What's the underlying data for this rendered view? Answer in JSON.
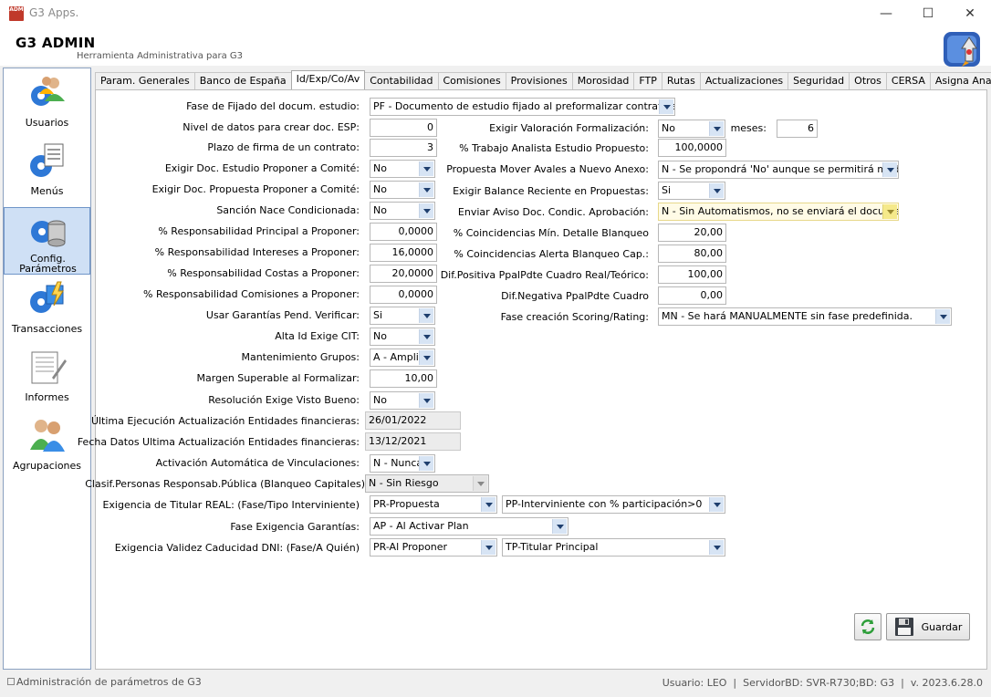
{
  "window": {
    "app_icon_text": "ADM",
    "title": "G3 Apps.",
    "minimize": "—",
    "maximize": "☐",
    "close": "✕"
  },
  "header": {
    "title": "G3 ADMIN",
    "subtitle": "Herramienta Administrativa para G3"
  },
  "sidebar": {
    "items": [
      {
        "label": "Usuarios",
        "icon": "users-gear-icon"
      },
      {
        "label": "Menús",
        "icon": "menu-gear-icon"
      },
      {
        "label": "Config. Parámetros",
        "icon": "database-gear-icon"
      },
      {
        "label": "Transacciones",
        "icon": "transaction-gear-icon"
      },
      {
        "label": "Informes",
        "icon": "report-icon"
      },
      {
        "label": "Agrupaciones",
        "icon": "group-icon"
      }
    ]
  },
  "tabs": [
    "Param. Generales",
    "Banco de España",
    "Id/Exp/Co/Av",
    "Contabilidad",
    "Comisiones",
    "Provisiones",
    "Morosidad",
    "FTP",
    "Rutas",
    "Actualizaciones",
    "Seguridad",
    "Otros",
    "CERSA",
    "Asigna Analista"
  ],
  "form": {
    "fase_fijado": {
      "label": "Fase de Fijado del docum. estudio:",
      "value": "PF - Documento de estudio fijado al preformalizar contrato/aval."
    },
    "nivel_datos": {
      "label": "Nivel de datos para crear doc. ESP:",
      "value": "0"
    },
    "plazo_firma": {
      "label": "Plazo de firma de un contrato:",
      "value": "3"
    },
    "exigir_doc_estudio": {
      "label": "Exigir Doc. Estudio Proponer a Comité:",
      "value": "No"
    },
    "exigir_doc_propuesta": {
      "label": "Exigir Doc. Propuesta Proponer a Comité:",
      "value": "No"
    },
    "sancion_condicionada": {
      "label": "Sanción Nace Condicionada:",
      "value": "No"
    },
    "resp_principal": {
      "label": "% Responsabilidad Principal a Proponer:",
      "value": "0,0000"
    },
    "resp_intereses": {
      "label": "% Responsabilidad Intereses a Proponer:",
      "value": "16,0000"
    },
    "resp_costas": {
      "label": "% Responsabilidad Costas a Proponer:",
      "value": "20,0000"
    },
    "resp_comisiones": {
      "label": "% Responsabilidad Comisiones a Proponer:",
      "value": "0,0000"
    },
    "usar_garantias": {
      "label": "Usar Garantías Pend. Verificar:",
      "value": "Si"
    },
    "alta_id_cit": {
      "label": "Alta Id Exige CIT:",
      "value": "No"
    },
    "mantenimiento_grupos": {
      "label": "Mantenimiento Grupos:",
      "value": "A - Ampliac"
    },
    "margen_superable": {
      "label": "Margen Superable al Formalizar:",
      "value": "10,00"
    },
    "resolucion_visto": {
      "label": "Resolución Exige Visto Bueno:",
      "value": "No"
    },
    "ultima_ejecucion": {
      "label": "Última Ejecución Actualización Entidades financieras:",
      "value": "26/01/2022"
    },
    "fecha_datos": {
      "label": "Fecha Datos Ultima Actualización Entidades financieras:",
      "value": "13/12/2021"
    },
    "activacion_vinc": {
      "label": "Activación Automática de Vinculaciones:",
      "value": "N - Nunca"
    },
    "clasif_personas": {
      "label": "Clasif.Personas Responsab.Pública (Blanqueo Capitales)",
      "value": "N - Sin Riesgo"
    },
    "exigencia_titular": {
      "label": "Exigencia de Titular REAL: (Fase/Tipo Interviniente)",
      "value1": "PR-Propuesta",
      "value2": "PP-Interviniente con % participación>0"
    },
    "fase_garantias": {
      "label": "Fase Exigencia Garantías:",
      "value": "AP - Al Activar Plan"
    },
    "validez_dni": {
      "label": "Exigencia Validez Caducidad DNI: (Fase/A Quién)",
      "value1": "PR-Al Proponer",
      "value2": "TP-Titular Principal"
    },
    "exigir_valoracion": {
      "label": "Exigir Valoración Formalización:",
      "value": "No"
    },
    "meses": {
      "label": "meses:",
      "value": "6"
    },
    "trabajo_analista": {
      "label": "% Trabajo Analista Estudio Propuesto:",
      "value": "100,0000"
    },
    "mover_avales": {
      "label": "Propuesta Mover Avales a Nuevo Anexo:",
      "value": "N - Se propondrá 'No' aunque se permitirá modificar"
    },
    "balance_reciente": {
      "label": "Exigir Balance Reciente en Propuestas:",
      "value": "Si"
    },
    "aviso_doc": {
      "label": "Enviar Aviso Doc. Condic. Aprobación:",
      "value": "N - Sin Automatismos, no se enviará el documento"
    },
    "coinc_min": {
      "label": "% Coincidencias Mín. Detalle Blanqueo",
      "value": "20,00"
    },
    "coinc_alerta": {
      "label": "% Coincidencias Alerta Blanqueo Cap.:",
      "value": "80,00"
    },
    "dif_positiva": {
      "label": "Dif.Positiva PpalPdte Cuadro Real/Teórico:",
      "value": "100,00"
    },
    "dif_negativa": {
      "label": "Dif.Negativa PpalPdte Cuadro",
      "value": "0,00"
    },
    "fase_scoring": {
      "label": "Fase creación Scoring/Rating:",
      "value": "MN - Se hará MANUALMENTE sin fase predefinida."
    }
  },
  "buttons": {
    "save_label": "Guardar"
  },
  "status": {
    "left": "Administración de parámetros de G3",
    "right": "Usuario: LEO  |  ServidorBD: SVR-R730;BD: G3  |  v. 2023.6.28.0"
  },
  "colors": {
    "selection": "#cfe0f5",
    "combo_arrow": "#d7e4f4",
    "highlight_field": "#fffbe6"
  }
}
